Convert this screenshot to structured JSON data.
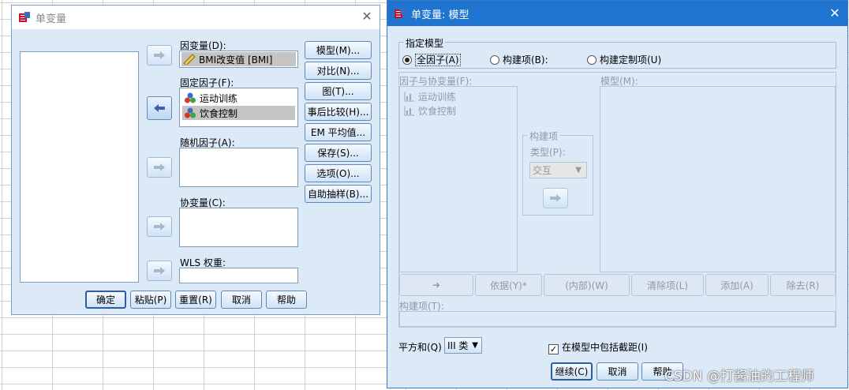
{
  "dialog1": {
    "title": "单变量",
    "dependent_label": "因变量(D):",
    "dependent_value": "BMI改变值 [BMI]",
    "fixed_label": "固定因子(F):",
    "fixed_items": [
      "运动训练",
      "饮食控制"
    ],
    "random_label": "随机因子(A):",
    "covariate_label": "协变量(C):",
    "wls_label": "WLS 权重:",
    "side_buttons": [
      "模型(M)...",
      "对比(N)...",
      "图(T)...",
      "事后比较(H)...",
      "EM 平均值...",
      "保存(S)...",
      "选项(O)...",
      "自助抽样(B)..."
    ],
    "bottom_buttons": [
      "确定",
      "粘贴(P)",
      "重置(R)",
      "取消",
      "帮助"
    ]
  },
  "dialog2": {
    "title": "单变量: 模型",
    "spec_legend": "指定模型",
    "radios": [
      "全因子(A)",
      "构建项(B):",
      "构建定制项(U)"
    ],
    "factors_label": "因子与协变量(F):",
    "factors": [
      "运动训练",
      "饮食控制"
    ],
    "model_label": "模型(M):",
    "build_legend": "构建项",
    "type_label": "类型(P):",
    "type_value": "交互",
    "row_buttons": [
      "依据(Y)*",
      "(内部)(W)",
      "清除项(L)",
      "添加(A)",
      "除去(R)"
    ],
    "build_term_label": "构建项(T):",
    "ss_label": "平方和(Q)",
    "ss_value": "III 类",
    "intercept_label": "在模型中包括截距(I)",
    "bottom_buttons": [
      "继续(C)",
      "取消",
      "帮助"
    ]
  },
  "watermark": "CSDN @打酱油的工程师"
}
